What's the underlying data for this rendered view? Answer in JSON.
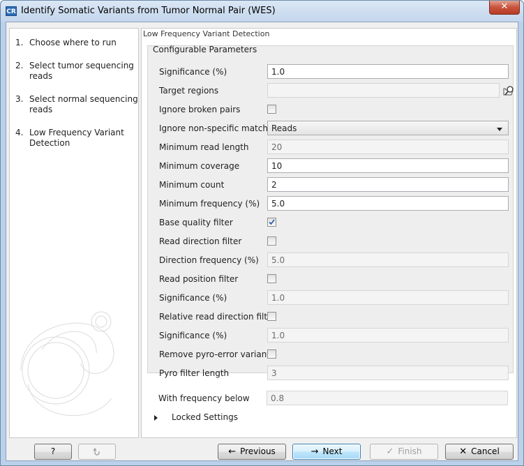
{
  "window": {
    "title": "Identify Somatic Variants from Tumor Normal Pair (WES)",
    "app_icon": "CR",
    "close_glyph": "✕"
  },
  "steps": [
    {
      "num": "1.",
      "label": "Choose where to run"
    },
    {
      "num": "2.",
      "label": "Select tumor sequencing reads"
    },
    {
      "num": "3.",
      "label": "Select normal sequencing reads"
    },
    {
      "num": "4.",
      "label": "Low Frequency Variant Detection"
    }
  ],
  "panel": {
    "title": "Low Frequency Variant Detection",
    "group_title": "Configurable Parameters",
    "params": {
      "significance": {
        "label": "Significance (%)",
        "value": "1.0"
      },
      "target_regions": {
        "label": "Target regions",
        "value": ""
      },
      "ignore_broken_pairs": {
        "label": "Ignore broken pairs",
        "checked": false
      },
      "ignore_nonspecific": {
        "label": "Ignore non-specific matches",
        "value": "Reads"
      },
      "min_read_length": {
        "label": "Minimum read length",
        "value": "20"
      },
      "min_coverage": {
        "label": "Minimum coverage",
        "value": "10"
      },
      "min_count": {
        "label": "Minimum count",
        "value": "2"
      },
      "min_frequency": {
        "label": "Minimum frequency (%)",
        "value": "5.0"
      },
      "base_quality_filter": {
        "label": "Base quality filter",
        "checked": true
      },
      "read_direction_filter": {
        "label": "Read direction filter",
        "checked": false
      },
      "direction_frequency": {
        "label": "Direction frequency (%)",
        "value": "5.0"
      },
      "read_position_filter": {
        "label": "Read position filter",
        "checked": false
      },
      "significance_2": {
        "label": "Significance (%)",
        "value": "1.0"
      },
      "relative_read_direction_filter": {
        "label": "Relative read direction filter",
        "checked": false
      },
      "significance_3": {
        "label": "Significance (%)",
        "value": "1.0"
      },
      "remove_pyro_error": {
        "label": "Remove pyro-error variants",
        "checked": false
      },
      "pyro_filter_length": {
        "label": "Pyro filter length",
        "value": "3"
      },
      "with_frequency_below": {
        "label": "With frequency below",
        "value": "0.8"
      }
    },
    "locked_settings": "Locked Settings"
  },
  "buttons": {
    "help": "?",
    "reset_icon": "undo-icon",
    "previous": "Previous",
    "next": "Next",
    "finish": "Finish",
    "cancel": "Cancel"
  }
}
